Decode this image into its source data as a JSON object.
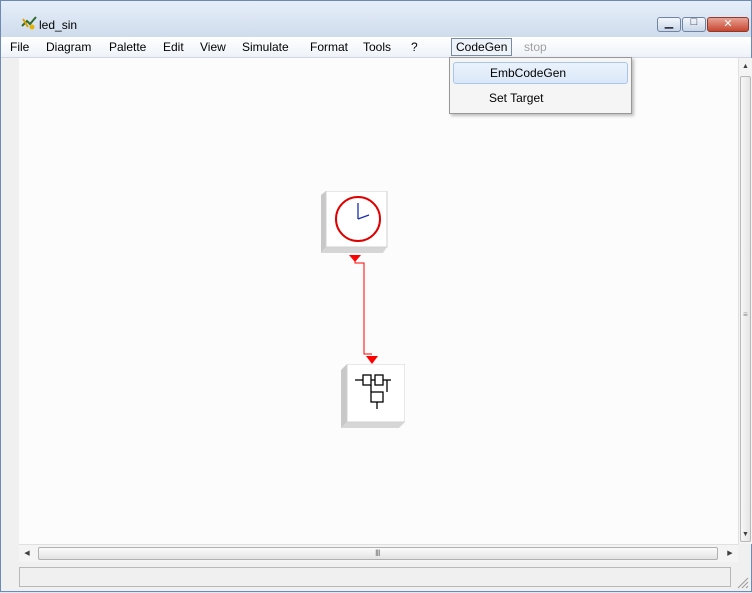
{
  "window": {
    "title": "led_sin",
    "controls": {
      "minimize": "minimize",
      "maximize": "maximize",
      "close": "close"
    }
  },
  "menubar": {
    "items": [
      {
        "label": "File"
      },
      {
        "label": "Diagram"
      },
      {
        "label": "Palette"
      },
      {
        "label": "Edit"
      },
      {
        "label": "View"
      },
      {
        "label": "Simulate"
      },
      {
        "label": "Format"
      },
      {
        "label": "Tools"
      },
      {
        "label": "?"
      },
      {
        "label": "CodeGen",
        "state": "open"
      },
      {
        "label": "stop",
        "state": "disabled"
      }
    ]
  },
  "codegen_menu": {
    "items": [
      {
        "label": "EmbCodeGen",
        "highlighted": true
      },
      {
        "label": "Set Target"
      }
    ]
  },
  "diagram": {
    "blocks": [
      {
        "name": "clock",
        "icon": "clock-icon"
      },
      {
        "name": "embedded-function",
        "icon": "function-block-icon"
      }
    ],
    "link_color": "#ff0000"
  },
  "colors": {
    "clock_outline": "#e00000",
    "clock_hands": "#1a2fb0",
    "link": "#ff0000",
    "menu_highlight": "#dbe8f8"
  },
  "scrollbars": {
    "vertical_grip": "≡",
    "horizontal_grip": "III"
  }
}
